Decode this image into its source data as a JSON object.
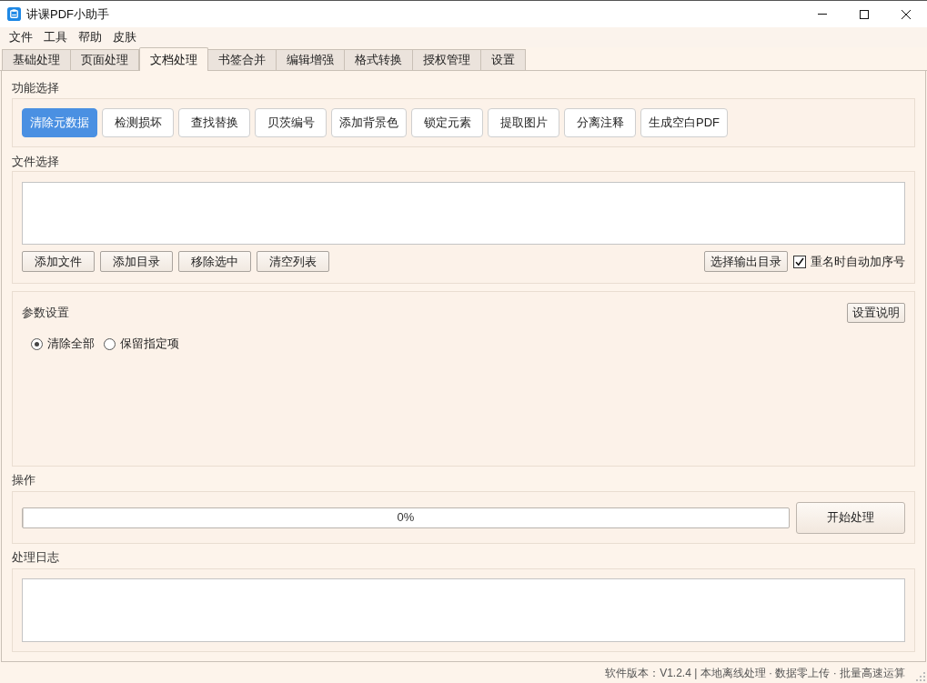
{
  "window": {
    "title": "讲课PDF小助手"
  },
  "menu": [
    "文件",
    "工具",
    "帮助",
    "皮肤"
  ],
  "tabs": [
    {
      "label": "基础处理",
      "selected": false
    },
    {
      "label": "页面处理",
      "selected": false
    },
    {
      "label": "文档处理",
      "selected": true
    },
    {
      "label": "书签合并",
      "selected": false
    },
    {
      "label": "编辑增强",
      "selected": false
    },
    {
      "label": "格式转换",
      "selected": false
    },
    {
      "label": "授权管理",
      "selected": false
    },
    {
      "label": "设置",
      "selected": false
    }
  ],
  "function_group": {
    "title": "功能选择",
    "buttons": [
      {
        "label": "清除元数据",
        "selected": true
      },
      {
        "label": "检测损坏",
        "selected": false
      },
      {
        "label": "查找替换",
        "selected": false
      },
      {
        "label": "贝茨编号",
        "selected": false
      },
      {
        "label": "添加背景色",
        "selected": false
      },
      {
        "label": "锁定元素",
        "selected": false
      },
      {
        "label": "提取图片",
        "selected": false
      },
      {
        "label": "分离注释",
        "selected": false
      },
      {
        "label": "生成空白PDF",
        "selected": false
      }
    ]
  },
  "file_group": {
    "title": "文件选择",
    "buttons": [
      "添加文件",
      "添加目录",
      "移除选中",
      "清空列表"
    ],
    "output_button": "选择输出目录",
    "auto_number": {
      "label": "重名时自动加序号",
      "checked": true
    }
  },
  "params_group": {
    "title": "参数设置",
    "help_button": "设置说明",
    "options": [
      {
        "label": "清除全部",
        "selected": true
      },
      {
        "label": "保留指定项",
        "selected": false
      }
    ]
  },
  "operation_group": {
    "title": "操作",
    "progress": {
      "level": 0,
      "reading": "0%"
    },
    "start_button": "开始处理"
  },
  "log_group": {
    "title": "处理日志"
  },
  "status_bar": "软件版本：V1.2.4 | 本地离线处理 · 数据零上传 · 批量高速运算"
}
